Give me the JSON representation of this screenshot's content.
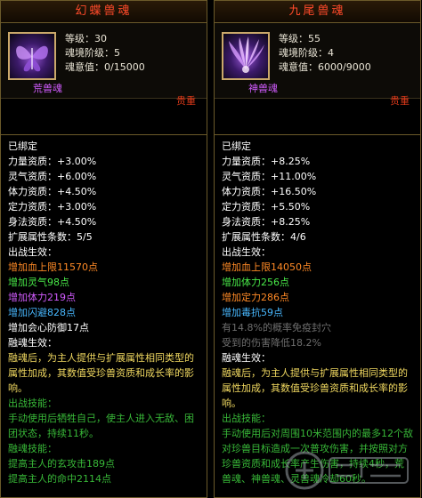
{
  "left": {
    "title": "幻蝶兽魂",
    "level": "等级：30",
    "realm": "魂境阶级：5",
    "soul_will": "魂意值：0/15000",
    "soul_kind": "荒兽魂",
    "rarity": "贵重",
    "bound": "已绑定",
    "attrs": [
      "力量资质：+3.00%",
      "灵气资质：+6.00%",
      "体力资质：+4.50%",
      "定力资质：+3.00%",
      "身法资质：+4.50%"
    ],
    "ext_count": "扩展属性条数：5/5",
    "battle_effect": "出战生效：",
    "ext": [
      "增加血上限11570点",
      "增加灵气98点",
      "增加体力219点",
      "增加闪避828点",
      "增加会心防御17点"
    ],
    "fusion_effect": "融魂生效：",
    "fusion_desc": "融魂后，为主人提供与扩展属性相同类型的属性加成，其数值受珍兽资质和成长率的影响。",
    "battle_skill_title": "出战技能：",
    "battle_skill": "手动使用后牺牲自己，使主人进入无敌、困团状态，持续11秒。",
    "fusion_skill_title": "融魂技能：",
    "fusion_skills": [
      "提高主人的玄攻击189点",
      "提高主人的命中2114点"
    ]
  },
  "right": {
    "title": "九尾兽魂",
    "level": "等级：55",
    "realm": "魂境阶级：4",
    "soul_will": "魂意值：6000/9000",
    "soul_kind": "神兽魂",
    "rarity": "贵重",
    "bound": "已绑定",
    "attrs": [
      "力量资质：+8.25%",
      "灵气资质：+11.00%",
      "体力资质：+16.50%",
      "定力资质：+5.50%",
      "身法资质：+8.25%"
    ],
    "ext_count": "扩展属性条数：4/6",
    "battle_effect": "出战生效：",
    "ext": [
      "增加血上限14050点",
      "增加体力256点",
      "增加定力286点",
      "增加毒抗59点"
    ],
    "gray": [
      "有14.8%的概率免疫封穴",
      "受到的伤害降低18.2%"
    ],
    "fusion_effect": "融魂生效：",
    "fusion_desc": "融魂后，为主人提供与扩展属性相同类型的属性加成，其数值受珍兽资质和成长率的影响。",
    "battle_skill_title": "出战技能：",
    "battle_skill": "手动使用后对周围10米范围内的最多12个敌对珍兽目标造成一次普攻伤害，并按照对方珍兽资质和成长率产生伤害，持续4秒，荒兽魂、神兽魂、灵兽魂冷却60秒。"
  }
}
